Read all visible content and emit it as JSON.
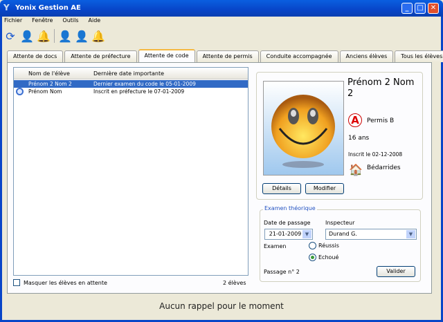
{
  "window": {
    "title": "Yonix Gestion AE",
    "minimize": "_",
    "maximize": "□",
    "close": "✕"
  },
  "menu": [
    "Fichier",
    "Fenêtre",
    "Outils",
    "Aide"
  ],
  "toolbar": [
    {
      "icon": "refresh-icon",
      "glyph": "⟳"
    },
    {
      "icon": "user-icon",
      "glyph": "👤"
    },
    {
      "icon": "bell-icon",
      "glyph": "🔔"
    },
    {
      "icon": "add-user-icon",
      "glyph": "👤"
    },
    {
      "icon": "add-person-icon",
      "glyph": "👤"
    },
    {
      "icon": "add-bell-icon",
      "glyph": "🔔"
    }
  ],
  "tabs": [
    "Attente de docs",
    "Attente de préfecture",
    "Attente de code",
    "Attente de permis",
    "Conduite accompagnée",
    "Anciens élèves",
    "Tous les élèves"
  ],
  "active_tab": "Attente de code",
  "list": {
    "columns": [
      "Nom de l'élève",
      "Dernière date importante"
    ],
    "rows": [
      {
        "name": "Prénom 2 Nom 2",
        "date": "Dernier examen du code le 05-01-2009",
        "selected": true
      },
      {
        "name": "Prénom Nom",
        "date": "Inscrit en préfecture le 07-01-2009",
        "icon": "clock-icon"
      }
    ]
  },
  "hide_waiting": {
    "label": "Masquer les élèves en attente",
    "checked": false
  },
  "count": "2 élèves",
  "student": {
    "name": "Prénom 2 Nom 2",
    "permis": "Permis B",
    "age": "16 ans",
    "inscrit": "Inscrit le 02-12-2008",
    "ville": "Bédarrides",
    "details": "Détails",
    "modifier": "Modifier"
  },
  "exam": {
    "legend": "Examen théorique",
    "date_label": "Date de passage",
    "date_value": "21-01-2009",
    "inspecteur_label": "Inspecteur",
    "inspecteur_value": "Durand G.",
    "examen_label": "Examen",
    "reussi": "Réussis",
    "echoue": "Echoué",
    "selected": "Echoué",
    "passage": "Passage n°  2",
    "valider": "Valider"
  },
  "status": "Aucun rappel pour le moment"
}
